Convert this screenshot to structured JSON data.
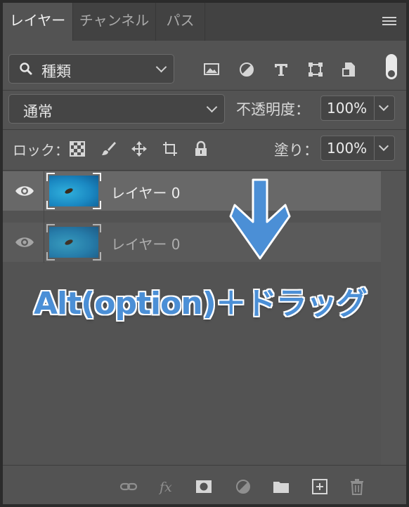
{
  "tabs": [
    {
      "label": "レイヤー",
      "active": true
    },
    {
      "label": "チャンネル",
      "active": false
    },
    {
      "label": "パス",
      "active": false
    }
  ],
  "filter": {
    "label": "種類"
  },
  "blend": {
    "mode": "通常"
  },
  "opacity": {
    "label": "不透明度：",
    "value": "100%"
  },
  "lock": {
    "label": "ロック："
  },
  "fill": {
    "label": "塗り：",
    "value": "100%"
  },
  "layers": [
    {
      "name": "レイヤー 0",
      "visible": true,
      "selected": true
    },
    {
      "name": "レイヤー 0",
      "visible": true,
      "selected": false,
      "dragging": true
    }
  ],
  "annotation": {
    "text": "Alt(option)＋ドラッグ",
    "color": "#4b8fd6"
  },
  "icons": {
    "filter": [
      "image-filter-icon",
      "adjustment-filter-icon",
      "type-filter-icon",
      "shape-filter-icon",
      "smart-object-filter-icon"
    ],
    "lock": [
      "lock-transparent-icon",
      "lock-image-icon",
      "lock-position-icon",
      "lock-artboard-icon",
      "lock-all-icon"
    ],
    "bottom": [
      "link-icon",
      "fx-icon",
      "mask-icon",
      "adjustment-layer-icon",
      "group-folder-icon",
      "new-layer-icon",
      "delete-icon"
    ]
  },
  "colors": {
    "panel": "#535353",
    "selected_row": "#686868",
    "accent": "#4b8fd6"
  }
}
